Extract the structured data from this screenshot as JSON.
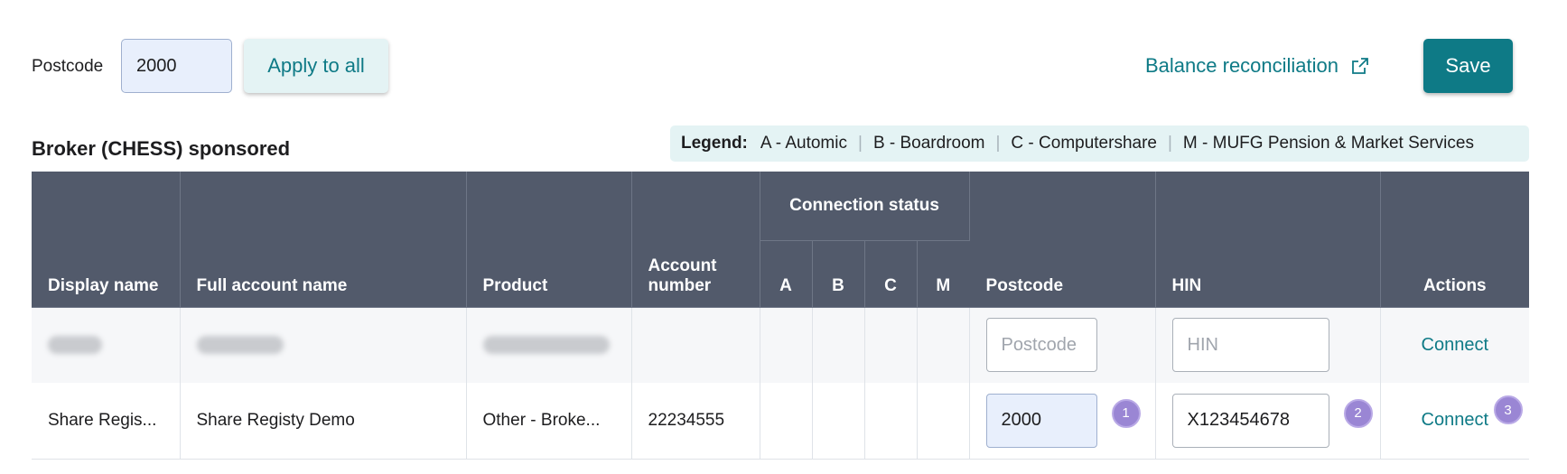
{
  "toolbar": {
    "postcode_label": "Postcode",
    "postcode_value": "2000",
    "apply_label": "Apply to all",
    "balance_link": "Balance reconciliation",
    "save_label": "Save"
  },
  "section": {
    "title": "Broker (CHESS) sponsored"
  },
  "legend": {
    "title": "Legend:",
    "items": [
      "A - Automic",
      "B - Boardroom",
      "C - Computershare",
      "M - MUFG Pension & Market Services"
    ]
  },
  "table": {
    "headers": {
      "display_name": "Display name",
      "full_account_name": "Full account name",
      "product": "Product",
      "account_number": "Account number",
      "connection_status": "Connection status",
      "status_cols": [
        "A",
        "B",
        "C",
        "M"
      ],
      "postcode": "Postcode",
      "hin": "HIN",
      "actions": "Actions"
    },
    "rows": [
      {
        "display_name": "",
        "full_account_name": "",
        "product": "",
        "account_number": "",
        "postcode_value": "",
        "postcode_placeholder": "Postcode",
        "hin_value": "",
        "hin_placeholder": "HIN",
        "action": "Connect"
      },
      {
        "display_name": "Share Regis...",
        "full_account_name": "Share Registy Demo",
        "product": "Other - Broke...",
        "account_number": "22234555",
        "postcode_value": "2000",
        "postcode_placeholder": "Postcode",
        "hin_value": "X123454678",
        "hin_placeholder": "HIN",
        "action": "Connect",
        "badges": [
          "1",
          "2",
          "3"
        ]
      }
    ]
  },
  "colors": {
    "accent": "#0e7a86",
    "header_bg": "#525a6b",
    "legend_bg": "#e4f3f4",
    "badge": "#9a86d4"
  },
  "icons": {
    "external_link": "external-link-icon"
  }
}
